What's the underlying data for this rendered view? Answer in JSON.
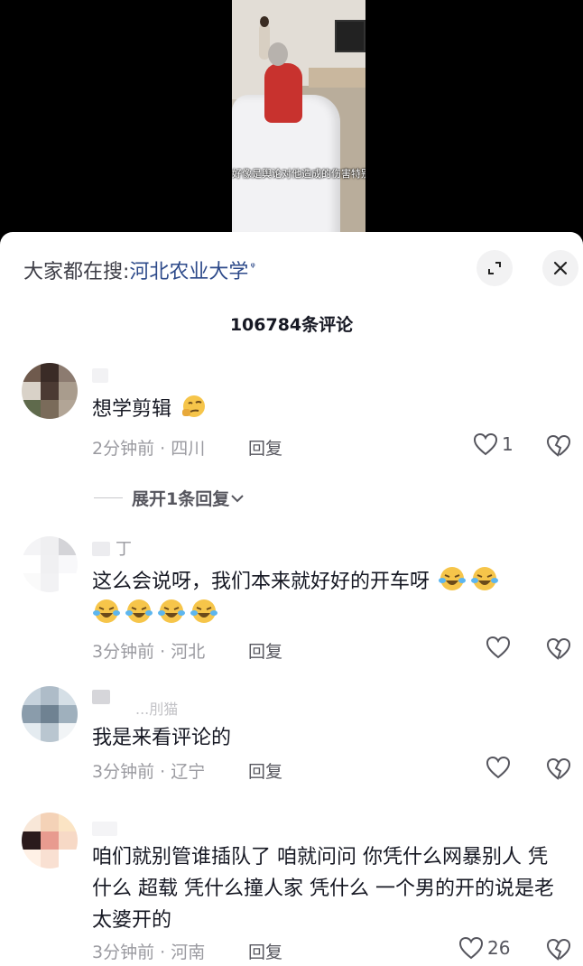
{
  "video": {
    "caption": "好像是舆论对他造成的伤害特别"
  },
  "header": {
    "search_prefix": "大家都在搜:",
    "search_term": "河北农业大学",
    "search_glyph": "ᵠ",
    "comment_count": "106784条评论"
  },
  "comments": [
    {
      "text": "想学剪辑",
      "time_location": "2分钟前 · 四川",
      "reply_label": "回复",
      "likes": "1",
      "expand_label": "展开1条回复"
    },
    {
      "name": "丁",
      "text": "这么会说呀，我们本来就好好的开车呀",
      "time_location": "3分钟前 · 河北",
      "reply_label": "回复",
      "likes": ""
    },
    {
      "name": "...刖猫",
      "text": "我是来看评论的",
      "time_location": "3分钟前 · 辽宁",
      "reply_label": "回复",
      "likes": ""
    },
    {
      "text": "咱们就别管谁插队了 咱就问问 你凭什么网暴别人 凭什么 超载 凭什么撞人家 凭什么 一个男的开的说是老太婆开的",
      "time_location": "3分钟前 · 河南",
      "reply_label": "回复",
      "likes": "26"
    }
  ],
  "colors": {
    "link": "#2d4a8a",
    "muted": "#9a9aa0",
    "text": "#161823"
  }
}
